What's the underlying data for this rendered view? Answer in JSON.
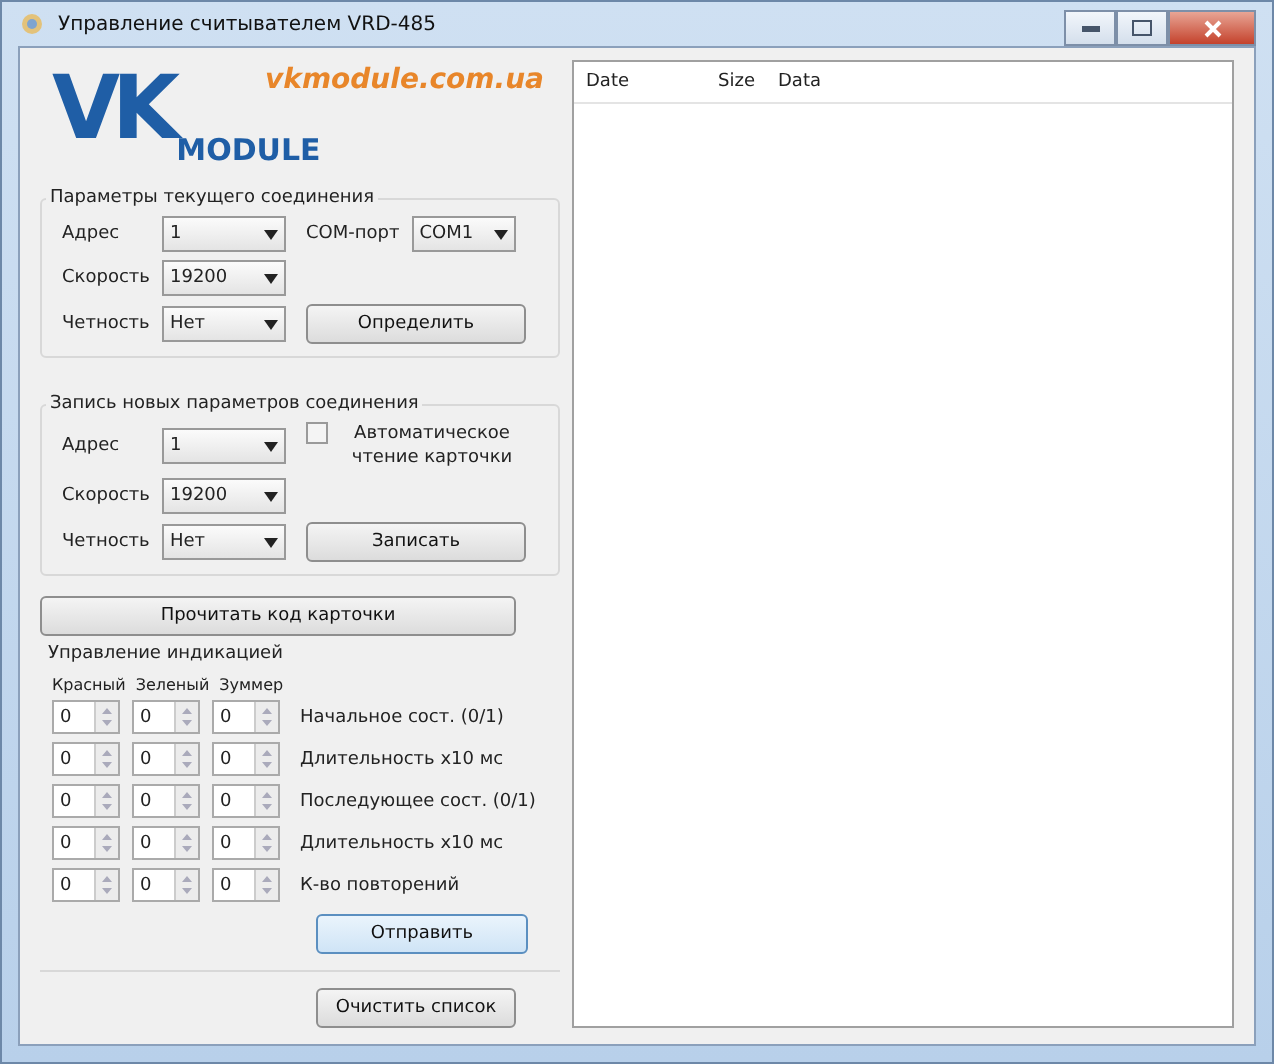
{
  "window": {
    "title": "Управление считывателем VRD-485"
  },
  "logo": {
    "initials": "VK",
    "word": "MODULE",
    "site": "vkmodule.com.ua"
  },
  "current_connection": {
    "title": "Параметры текущего соединения",
    "fields": [
      {
        "label": "Адрес",
        "value": "1"
      },
      {
        "label": "Скорость",
        "value": "19200"
      },
      {
        "label": "Четность",
        "value": "Нет"
      }
    ],
    "com_port": {
      "label": "COM-порт",
      "value": "COM1"
    },
    "button": "Определить"
  },
  "new_connection": {
    "title": "Запись новых параметров соединения",
    "fields": [
      {
        "label": "Адрес",
        "value": "1"
      },
      {
        "label": "Скорость",
        "value": "19200"
      },
      {
        "label": "Четность",
        "value": "Нет"
      }
    ],
    "auto_read": {
      "label": "Автоматическое чтение карточки",
      "checked": false
    },
    "button": "Записать"
  },
  "read_button": "Прочитать код карточки",
  "indication": {
    "title": "Управление индикацией",
    "columns": [
      "Красный",
      "Зеленый",
      "Зуммер"
    ],
    "rows": [
      {
        "values": [
          "0",
          "0",
          "0"
        ],
        "label": "Начальное сост. (0/1)"
      },
      {
        "values": [
          "0",
          "0",
          "0"
        ],
        "label": "Длительность x10 мс"
      },
      {
        "values": [
          "0",
          "0",
          "0"
        ],
        "label": "Последующее сост. (0/1)"
      },
      {
        "values": [
          "0",
          "0",
          "0"
        ],
        "label": "Длительность x10 мс"
      },
      {
        "values": [
          "0",
          "0",
          "0"
        ],
        "label": "К-во повторений"
      }
    ],
    "button": "Отправить"
  },
  "clear_button": "Очистить список",
  "list": {
    "columns": [
      "Date",
      "Size",
      "Data"
    ]
  }
}
